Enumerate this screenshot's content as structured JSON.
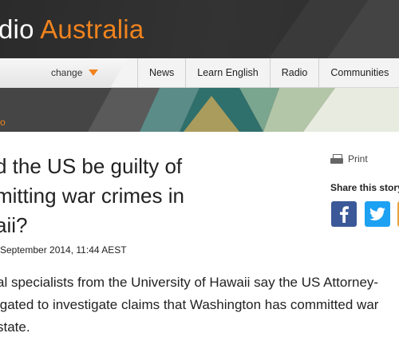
{
  "header": {
    "logo_part1": "dio ",
    "logo_part2": "Australia"
  },
  "nav": {
    "change_label": "change",
    "items": [
      "News",
      "Learn English",
      "Radio",
      "Communities"
    ]
  },
  "breadcrumb": "o",
  "article": {
    "headline_lines": [
      "d the US be guilty of",
      "mitting war crimes in",
      "aii?"
    ],
    "dateline": "September 2014, 11:44 AEST",
    "body_lines": [
      "al specialists from the University of Hawaii say the US Attorney-",
      "igated to investigate claims that Washington has committed war",
      " state."
    ]
  },
  "sidebar": {
    "print_label": "Print",
    "share_title": "Share this story",
    "share_icons": [
      "facebook-icon",
      "twitter-icon"
    ]
  },
  "colors": {
    "accent_orange": "#f0831e",
    "facebook_blue": "#3b5998",
    "twitter_blue": "#1da1f2",
    "header_dark": "#2b2b2b"
  }
}
